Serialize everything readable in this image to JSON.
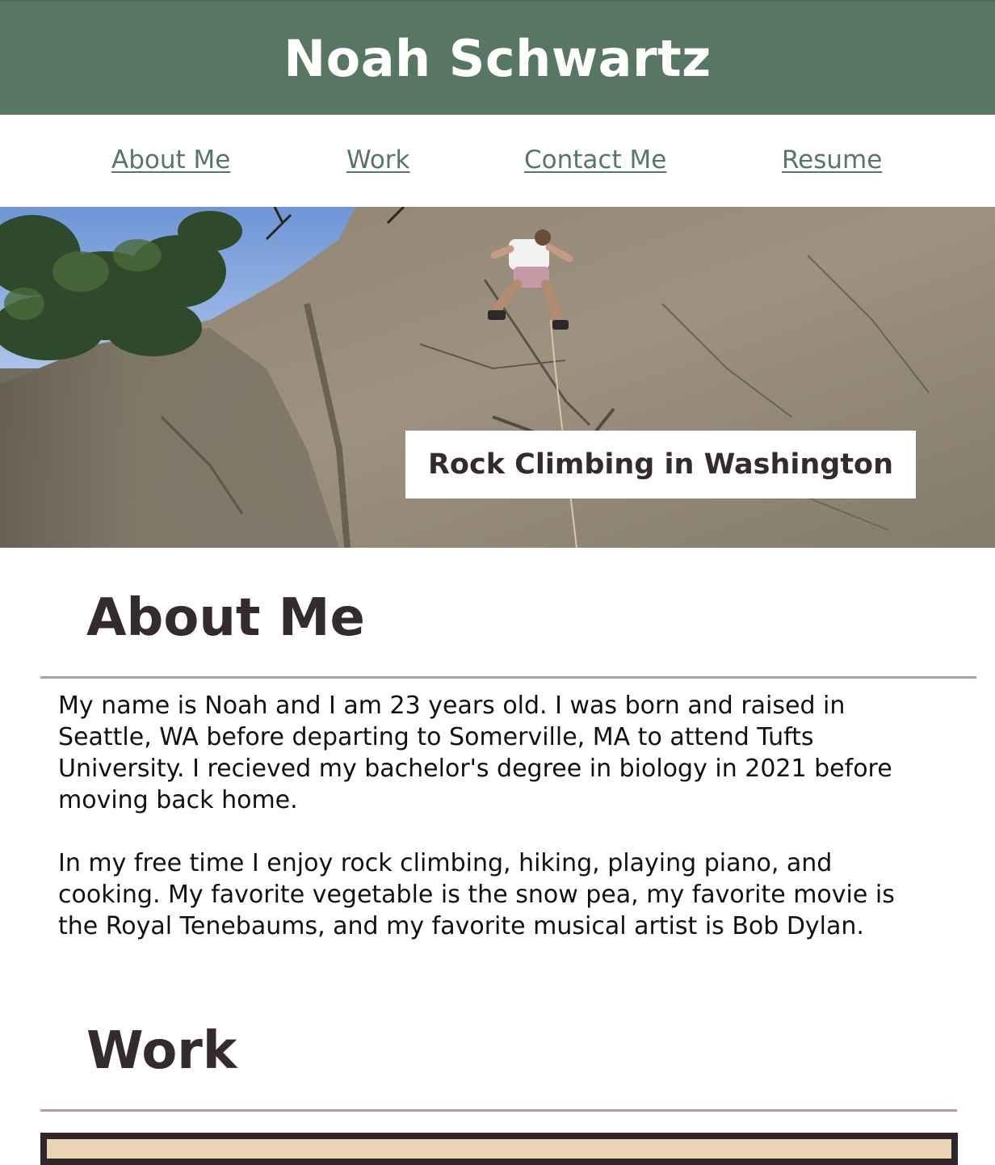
{
  "header": {
    "title": "Noah Schwartz"
  },
  "nav": {
    "items": [
      {
        "label": "About Me"
      },
      {
        "label": "Work"
      },
      {
        "label": "Contact Me"
      },
      {
        "label": "Resume"
      }
    ]
  },
  "hero": {
    "caption": "Rock Climbing in Washington"
  },
  "about": {
    "title": "About Me",
    "paragraphs": [
      "My name is Noah and I am 23 years old. I was born and raised in Seattle, WA before departing to Somerville, MA to attend Tufts University. I recieved my bachelor's degree in biology in 2021 before moving back home.",
      "In my free time I enjoy rock climbing, hiking, playing piano, and cooking. My favorite vegetable is the snow pea, my favorite movie is the Royal Tenebaums, and my favorite musical artist is Bob Dylan."
    ]
  },
  "work": {
    "title": "Work"
  },
  "colors": {
    "header_bg": "#587763",
    "link": "#587763",
    "heading_text": "#352a2e",
    "rule": "#b89c9d"
  }
}
